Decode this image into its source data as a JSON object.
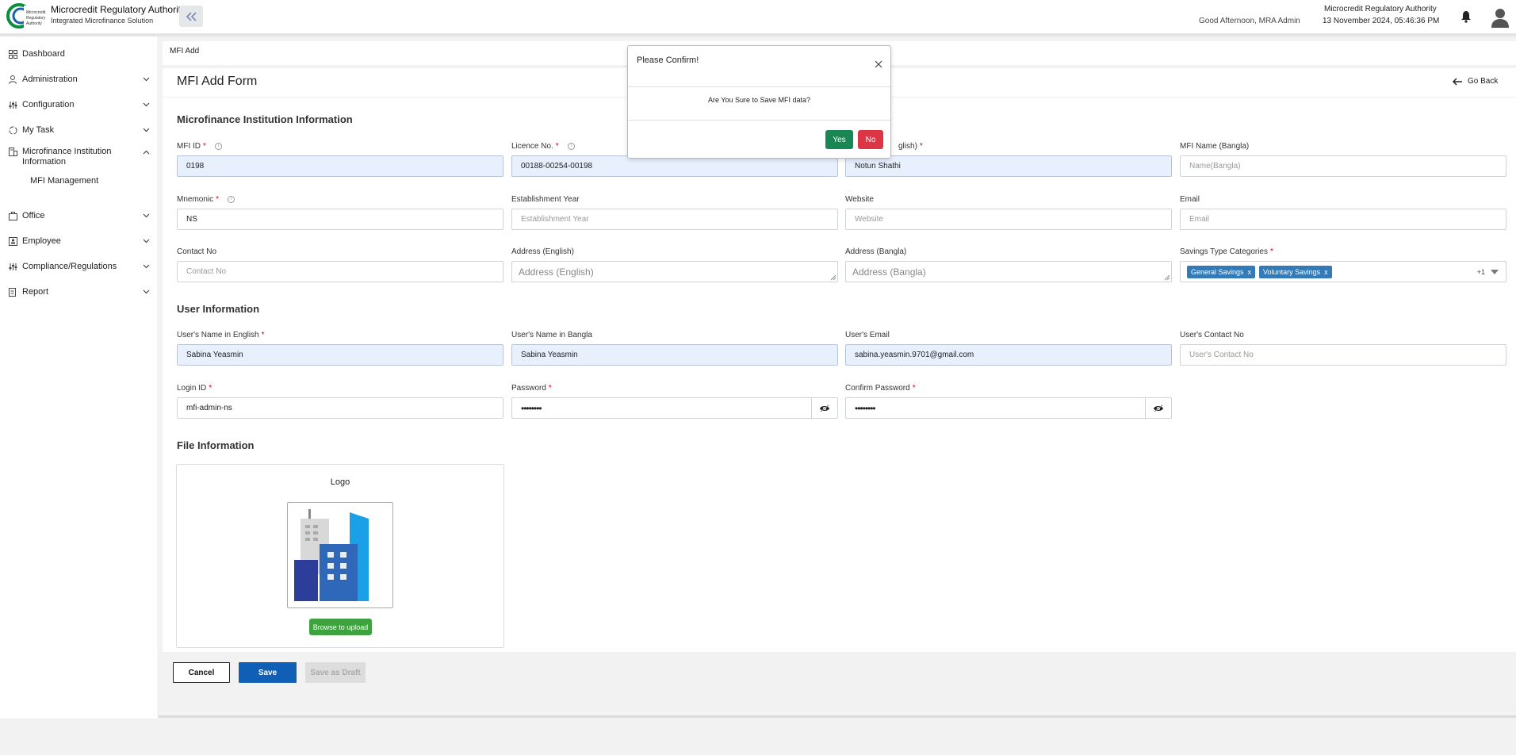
{
  "header": {
    "brand_title": "Microcredit Regulatory Authority",
    "brand_subtitle": "Integrated Microfinance Solution",
    "logo_text": "Microcredit Regulatory Authority",
    "greeting": "Good Afternoon, MRA Admin",
    "org_name": "Microcredit Regulatory Authority",
    "datetime": "13 November 2024, 05:46:36 PM"
  },
  "sidebar": {
    "items": [
      {
        "label": "Dashboard",
        "icon": "dashboard-icon"
      },
      {
        "label": "Administration",
        "icon": "admin-user-icon"
      },
      {
        "label": "Configuration",
        "icon": "sliders-icon"
      },
      {
        "label": "My Task",
        "icon": "task-icon"
      },
      {
        "label": "Microfinance Institution Information",
        "icon": "institution-icon"
      },
      {
        "label": "Office",
        "icon": "office-icon"
      },
      {
        "label": "Employee",
        "icon": "employee-icon"
      },
      {
        "label": "Compliance/Regulations",
        "icon": "sliders-icon"
      },
      {
        "label": "Report",
        "icon": "report-icon"
      }
    ],
    "sub_item": "MFI Management"
  },
  "breadcrumb": "MFI Add",
  "form": {
    "title": "MFI Add Form",
    "go_back": "Go Back",
    "section_institution": "Microfinance Institution Information",
    "section_user": "User Information",
    "section_file": "File Information",
    "fields": {
      "mfi_id": {
        "label": "MFI ID",
        "value": "0198"
      },
      "licence_no": {
        "label": "Licence No.",
        "value": "00188-00254-00198"
      },
      "mfi_name_en": {
        "label": "glish)",
        "value": "Notun Shathi"
      },
      "mfi_name_bn": {
        "label": "MFI Name (Bangla)",
        "placeholder": "Name(Bangla)"
      },
      "mnemonic": {
        "label": "Mnemonic",
        "value": "NS"
      },
      "establishment_year": {
        "label": "Establishment Year",
        "placeholder": "Establishment Year"
      },
      "website": {
        "label": "Website",
        "placeholder": "Website"
      },
      "email": {
        "label": "Email",
        "placeholder": "Email"
      },
      "contact_no": {
        "label": "Contact No",
        "placeholder": "Contact No"
      },
      "address_en": {
        "label": "Address (English)",
        "placeholder": "Address (English)"
      },
      "address_bn": {
        "label": "Address (Bangla)",
        "placeholder": "Address (Bangla)"
      },
      "savings_types": {
        "label": "Savings Type Categories",
        "tags": [
          "General Savings",
          "Voluntary Savings"
        ],
        "tag_remove": "x",
        "more": "+1"
      },
      "user_name_en": {
        "label": "User's Name in English",
        "value": "Sabina Yeasmin"
      },
      "user_name_bn": {
        "label": "User's Name in Bangla",
        "value": "Sabina Yeasmin"
      },
      "user_email": {
        "label": "User's Email",
        "value": "sabina.yeasmin.9701@gmail.com"
      },
      "user_contact": {
        "label": "User's Contact No",
        "placeholder": "User's Contact No"
      },
      "login_id": {
        "label": "Login ID",
        "value": "mfi-admin-ns"
      },
      "password": {
        "label": "Password",
        "value": "••••••••"
      },
      "confirm_password": {
        "label": "Confirm Password",
        "value": "••••••••"
      }
    },
    "file": {
      "logo_label": "Logo",
      "upload_button": "Browse to upload"
    },
    "buttons": {
      "cancel": "Cancel",
      "save": "Save",
      "save_draft": "Save as Draft"
    }
  },
  "modal": {
    "title": "Please Confirm!",
    "message": "Are You Sure to Save MFI data?",
    "yes": "Yes",
    "no": "No"
  },
  "colors": {
    "primary": "#0f5fb6",
    "success": "#198754",
    "danger": "#dc3545",
    "upload": "#3ea33e",
    "tag": "#337ab7",
    "required": "#d0021b",
    "filled_bg": "#e8f0fe"
  }
}
